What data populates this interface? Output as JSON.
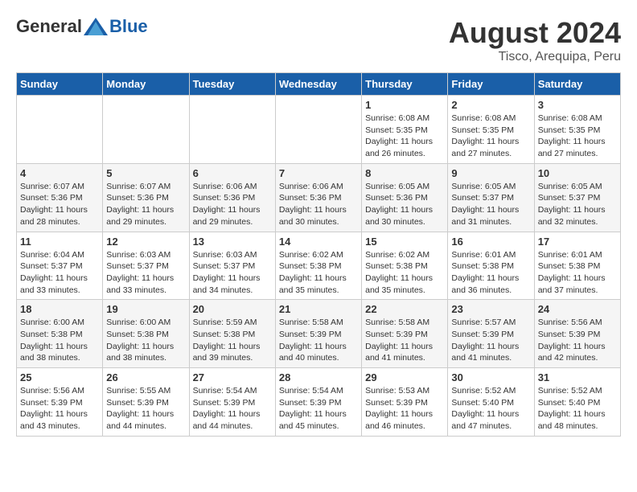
{
  "header": {
    "logo_general": "General",
    "logo_blue": "Blue",
    "month_year": "August 2024",
    "location": "Tisco, Arequipa, Peru"
  },
  "weekdays": [
    "Sunday",
    "Monday",
    "Tuesday",
    "Wednesday",
    "Thursday",
    "Friday",
    "Saturday"
  ],
  "weeks": [
    [
      {
        "day": "",
        "info": ""
      },
      {
        "day": "",
        "info": ""
      },
      {
        "day": "",
        "info": ""
      },
      {
        "day": "",
        "info": ""
      },
      {
        "day": "1",
        "info": "Sunrise: 6:08 AM\nSunset: 5:35 PM\nDaylight: 11 hours and 26 minutes."
      },
      {
        "day": "2",
        "info": "Sunrise: 6:08 AM\nSunset: 5:35 PM\nDaylight: 11 hours and 27 minutes."
      },
      {
        "day": "3",
        "info": "Sunrise: 6:08 AM\nSunset: 5:35 PM\nDaylight: 11 hours and 27 minutes."
      }
    ],
    [
      {
        "day": "4",
        "info": "Sunrise: 6:07 AM\nSunset: 5:36 PM\nDaylight: 11 hours and 28 minutes."
      },
      {
        "day": "5",
        "info": "Sunrise: 6:07 AM\nSunset: 5:36 PM\nDaylight: 11 hours and 29 minutes."
      },
      {
        "day": "6",
        "info": "Sunrise: 6:06 AM\nSunset: 5:36 PM\nDaylight: 11 hours and 29 minutes."
      },
      {
        "day": "7",
        "info": "Sunrise: 6:06 AM\nSunset: 5:36 PM\nDaylight: 11 hours and 30 minutes."
      },
      {
        "day": "8",
        "info": "Sunrise: 6:05 AM\nSunset: 5:36 PM\nDaylight: 11 hours and 30 minutes."
      },
      {
        "day": "9",
        "info": "Sunrise: 6:05 AM\nSunset: 5:37 PM\nDaylight: 11 hours and 31 minutes."
      },
      {
        "day": "10",
        "info": "Sunrise: 6:05 AM\nSunset: 5:37 PM\nDaylight: 11 hours and 32 minutes."
      }
    ],
    [
      {
        "day": "11",
        "info": "Sunrise: 6:04 AM\nSunset: 5:37 PM\nDaylight: 11 hours and 33 minutes."
      },
      {
        "day": "12",
        "info": "Sunrise: 6:03 AM\nSunset: 5:37 PM\nDaylight: 11 hours and 33 minutes."
      },
      {
        "day": "13",
        "info": "Sunrise: 6:03 AM\nSunset: 5:37 PM\nDaylight: 11 hours and 34 minutes."
      },
      {
        "day": "14",
        "info": "Sunrise: 6:02 AM\nSunset: 5:38 PM\nDaylight: 11 hours and 35 minutes."
      },
      {
        "day": "15",
        "info": "Sunrise: 6:02 AM\nSunset: 5:38 PM\nDaylight: 11 hours and 35 minutes."
      },
      {
        "day": "16",
        "info": "Sunrise: 6:01 AM\nSunset: 5:38 PM\nDaylight: 11 hours and 36 minutes."
      },
      {
        "day": "17",
        "info": "Sunrise: 6:01 AM\nSunset: 5:38 PM\nDaylight: 11 hours and 37 minutes."
      }
    ],
    [
      {
        "day": "18",
        "info": "Sunrise: 6:00 AM\nSunset: 5:38 PM\nDaylight: 11 hours and 38 minutes."
      },
      {
        "day": "19",
        "info": "Sunrise: 6:00 AM\nSunset: 5:38 PM\nDaylight: 11 hours and 38 minutes."
      },
      {
        "day": "20",
        "info": "Sunrise: 5:59 AM\nSunset: 5:38 PM\nDaylight: 11 hours and 39 minutes."
      },
      {
        "day": "21",
        "info": "Sunrise: 5:58 AM\nSunset: 5:39 PM\nDaylight: 11 hours and 40 minutes."
      },
      {
        "day": "22",
        "info": "Sunrise: 5:58 AM\nSunset: 5:39 PM\nDaylight: 11 hours and 41 minutes."
      },
      {
        "day": "23",
        "info": "Sunrise: 5:57 AM\nSunset: 5:39 PM\nDaylight: 11 hours and 41 minutes."
      },
      {
        "day": "24",
        "info": "Sunrise: 5:56 AM\nSunset: 5:39 PM\nDaylight: 11 hours and 42 minutes."
      }
    ],
    [
      {
        "day": "25",
        "info": "Sunrise: 5:56 AM\nSunset: 5:39 PM\nDaylight: 11 hours and 43 minutes."
      },
      {
        "day": "26",
        "info": "Sunrise: 5:55 AM\nSunset: 5:39 PM\nDaylight: 11 hours and 44 minutes."
      },
      {
        "day": "27",
        "info": "Sunrise: 5:54 AM\nSunset: 5:39 PM\nDaylight: 11 hours and 44 minutes."
      },
      {
        "day": "28",
        "info": "Sunrise: 5:54 AM\nSunset: 5:39 PM\nDaylight: 11 hours and 45 minutes."
      },
      {
        "day": "29",
        "info": "Sunrise: 5:53 AM\nSunset: 5:39 PM\nDaylight: 11 hours and 46 minutes."
      },
      {
        "day": "30",
        "info": "Sunrise: 5:52 AM\nSunset: 5:40 PM\nDaylight: 11 hours and 47 minutes."
      },
      {
        "day": "31",
        "info": "Sunrise: 5:52 AM\nSunset: 5:40 PM\nDaylight: 11 hours and 48 minutes."
      }
    ]
  ]
}
